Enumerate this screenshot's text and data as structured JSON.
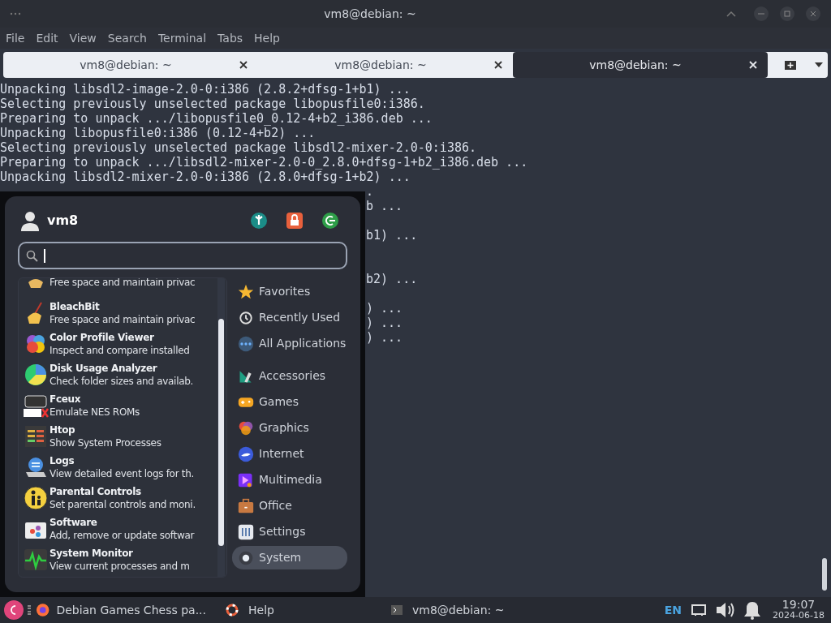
{
  "window": {
    "title": "vm8@debian: ~",
    "menu": [
      "File",
      "Edit",
      "View",
      "Search",
      "Terminal",
      "Tabs",
      "Help"
    ]
  },
  "tabs": [
    {
      "label": "vm8@debian: ~",
      "selected": false
    },
    {
      "label": "vm8@debian: ~",
      "selected": false
    },
    {
      "label": "vm8@debian: ~",
      "selected": true
    }
  ],
  "terminal": {
    "lines": [
      {
        "kind": "full",
        "text": "Unpacking libsdl2-image-2.0-0:i386 (2.8.2+dfsg-1+b1) ..."
      },
      {
        "kind": "full",
        "text": "Selecting previously unselected package libopusfile0:i386."
      },
      {
        "kind": "full",
        "text": "Preparing to unpack .../libopusfile0_0.12-4+b2_i386.deb ..."
      },
      {
        "kind": "full",
        "text": "Unpacking libopusfile0:i386 (0.12-4+b2) ..."
      },
      {
        "kind": "full",
        "text": "Selecting previously unselected package libsdl2-mixer-2.0-0:i386."
      },
      {
        "kind": "full",
        "text": "Preparing to unpack .../libsdl2-mixer-2.0-0_2.8.0+dfsg-1+b2_i386.deb ..."
      },
      {
        "kind": "full",
        "text": "Unpacking libsdl2-mixer-2.0-0:i386 (2.8.0+dfsg-1+b2) ..."
      },
      {
        "kind": "partial",
        "text": "."
      },
      {
        "kind": "partial",
        "text": "b ..."
      },
      {
        "kind": "blank"
      },
      {
        "kind": "partial",
        "text": "b1) ..."
      },
      {
        "kind": "blank"
      },
      {
        "kind": "blank"
      },
      {
        "kind": "partial",
        "text": "b2) ..."
      },
      {
        "kind": "blank"
      },
      {
        "kind": "partial",
        "text": ") ..."
      },
      {
        "kind": "partial",
        "text": ") ..."
      },
      {
        "kind": "partial",
        "text": ") ..."
      }
    ]
  },
  "app_menu": {
    "user": "vm8",
    "apps": [
      {
        "description": "Free space and maintain privac"
      },
      {
        "name": "BleachBit",
        "description": "Free space and maintain privac"
      },
      {
        "name": "Color Profile Viewer",
        "description": "Inspect and compare installed"
      },
      {
        "name": "Disk Usage Analyzer",
        "description": "Check folder sizes and availab."
      },
      {
        "name": "Fceux",
        "description": "Emulate NES ROMs"
      },
      {
        "name": "Htop",
        "description": "Show System Processes"
      },
      {
        "name": "Logs",
        "description": "View detailed event logs for th."
      },
      {
        "name": "Parental Controls",
        "description": "Set parental controls and moni."
      },
      {
        "name": "Software",
        "description": "Add, remove or update softwar"
      },
      {
        "name": "System Monitor",
        "description": "View current processes and m"
      }
    ],
    "categories": [
      {
        "label": "Favorites",
        "selected": false
      },
      {
        "label": "Recently Used",
        "selected": false
      },
      {
        "label": "All Applications",
        "selected": false
      },
      {
        "label": "Accessories",
        "selected": false
      },
      {
        "label": "Games",
        "selected": false
      },
      {
        "label": "Graphics",
        "selected": false
      },
      {
        "label": "Internet",
        "selected": false
      },
      {
        "label": "Multimedia",
        "selected": false
      },
      {
        "label": "Office",
        "selected": false
      },
      {
        "label": "Settings",
        "selected": false
      },
      {
        "label": "System",
        "selected": true
      }
    ]
  },
  "taskbar": {
    "tasks": [
      "Debian Games Chess pa...",
      "Help",
      "vm8@debian: ~"
    ],
    "language": "EN",
    "time": "19:07",
    "date": "2024-06-18"
  }
}
